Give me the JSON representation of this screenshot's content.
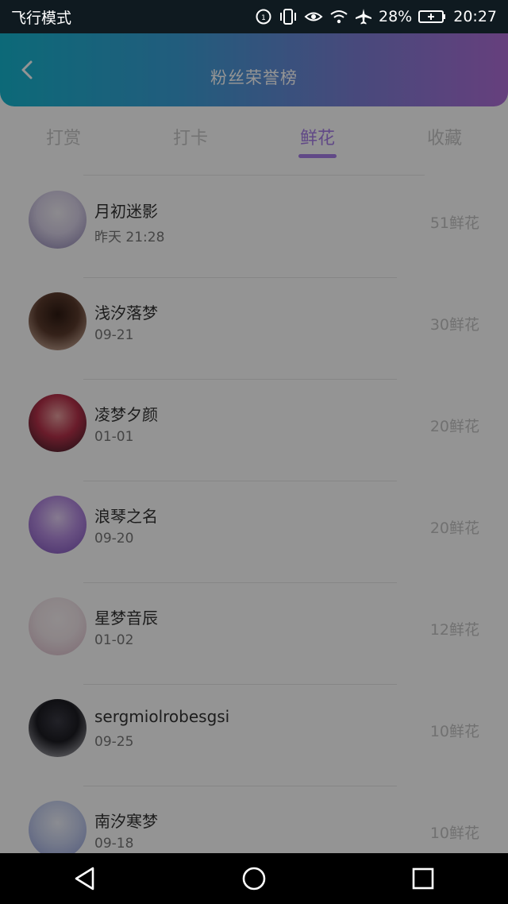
{
  "status_bar": {
    "mode": "飞行模式",
    "battery": "28%",
    "time": "20:27"
  },
  "header": {
    "title": "粉丝荣誉榜"
  },
  "tabs": [
    {
      "label": "打赏"
    },
    {
      "label": "打卡"
    },
    {
      "label": "鲜花"
    },
    {
      "label": "收藏"
    }
  ],
  "active_tab": "鲜花",
  "colors": {
    "accent": "#a87fe8",
    "header_gradient_start": "#16b6cf",
    "header_gradient_end": "#b06ed8"
  },
  "fans": [
    {
      "name": "月初迷影",
      "date": "昨天 21:28",
      "count": "51鲜花",
      "avatar_colors": [
        "#d9d2e8",
        "#8a7fb0",
        "#f1eef5"
      ]
    },
    {
      "name": "浅汐落梦",
      "date": "09-21",
      "count": "30鲜花",
      "avatar_colors": [
        "#5a3a2c",
        "#e7c7b4",
        "#2e1a12"
      ]
    },
    {
      "name": "凌梦夕颜",
      "date": "01-01",
      "count": "20鲜花",
      "avatar_colors": [
        "#b6314a",
        "#2b1b22",
        "#e9a0a0"
      ]
    },
    {
      "name": "浪琴之名",
      "date": "09-20",
      "count": "20鲜花",
      "avatar_colors": [
        "#b58ce0",
        "#7b4fb8",
        "#e6d2f7"
      ]
    },
    {
      "name": "星梦音辰",
      "date": "01-02",
      "count": "12鲜花",
      "avatar_colors": [
        "#f2e6ea",
        "#d9b7c6",
        "#f9f2f4"
      ]
    },
    {
      "name": "sergmiolrobesgsi",
      "date": "09-25",
      "count": "10鲜花",
      "avatar_colors": [
        "#1c1c22",
        "#c7c7cf",
        "#3a3a44"
      ]
    },
    {
      "name": "南汐寒梦",
      "date": "09-18",
      "count": "10鲜花",
      "avatar_colors": [
        "#c9d2ef",
        "#8f9cd8",
        "#eef1fb"
      ]
    }
  ]
}
